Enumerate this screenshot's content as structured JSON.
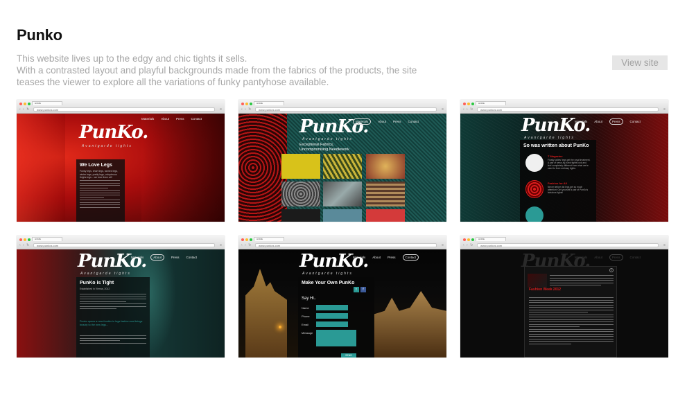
{
  "project": {
    "title": "Punko",
    "description": [
      "This website lives up to the edgy and chic tights it sells.",
      "With a contrasted layout and playful backgrounds made from the fabrics of the products, the site",
      "teases the viewer to explore all the variations of funky pantyhose available."
    ],
    "view_label": "View site"
  },
  "browser": {
    "tab": "HOME",
    "url": "www.punkos.com"
  },
  "site": {
    "logo": "PunKo.",
    "tagline": "Avantgarde tights",
    "nav": [
      "Materials",
      "About",
      "Press",
      "Contact"
    ]
  },
  "screens": [
    {
      "name": "home",
      "heading": "We Love Legs",
      "subheading": "Funky legs, short legs, tanned legs, winter legs, pretty legs, volupteous thighs legs... we love them all!"
    },
    {
      "name": "materials",
      "heading": "Exceptional Fabrics,",
      "heading2": "Uncompromising Needlework",
      "swatches": [
        "#d8c21a",
        "#c9b53a",
        "#d6a93c",
        "#7a6f70",
        "#8a8a8a",
        "#b08a5a",
        "#1b1b1b",
        "#5a8a9a",
        "#d43a3a"
      ]
    },
    {
      "name": "press",
      "heading": "So was written about PunKo",
      "items": [
        {
          "source": "T Magazine",
          "quote": "Finally ladies' legs get the royal treatment. A pair of sewn-by-hand tights look and feel completely different from what we're used to from ordinary tights."
        },
        {
          "source": "Fashion for All",
          "quote": "Never before did legs get so much attention! Get yourself a pair of PunKo's fabulous tights!"
        }
      ]
    },
    {
      "name": "about",
      "heading": "PunKo is Tight",
      "subheading": "Established in Vienna, 2012",
      "highlight": "Punko opens a new frontier in legs fashion and brings beauty to the new legs..."
    },
    {
      "name": "contact",
      "heading": "Make Your Own PunKo",
      "say_hi": "Say Hi..",
      "fields": [
        "Name",
        "Phone",
        "Email",
        "Message"
      ],
      "send": "SEND"
    },
    {
      "name": "news",
      "heading": "Fashion Week 2012"
    }
  ],
  "colors": {
    "accent_red": "#d91d1d",
    "accent_teal": "#2a9a95",
    "button_bg": "#e6e6e6",
    "desc_text": "#a6a6a6"
  }
}
